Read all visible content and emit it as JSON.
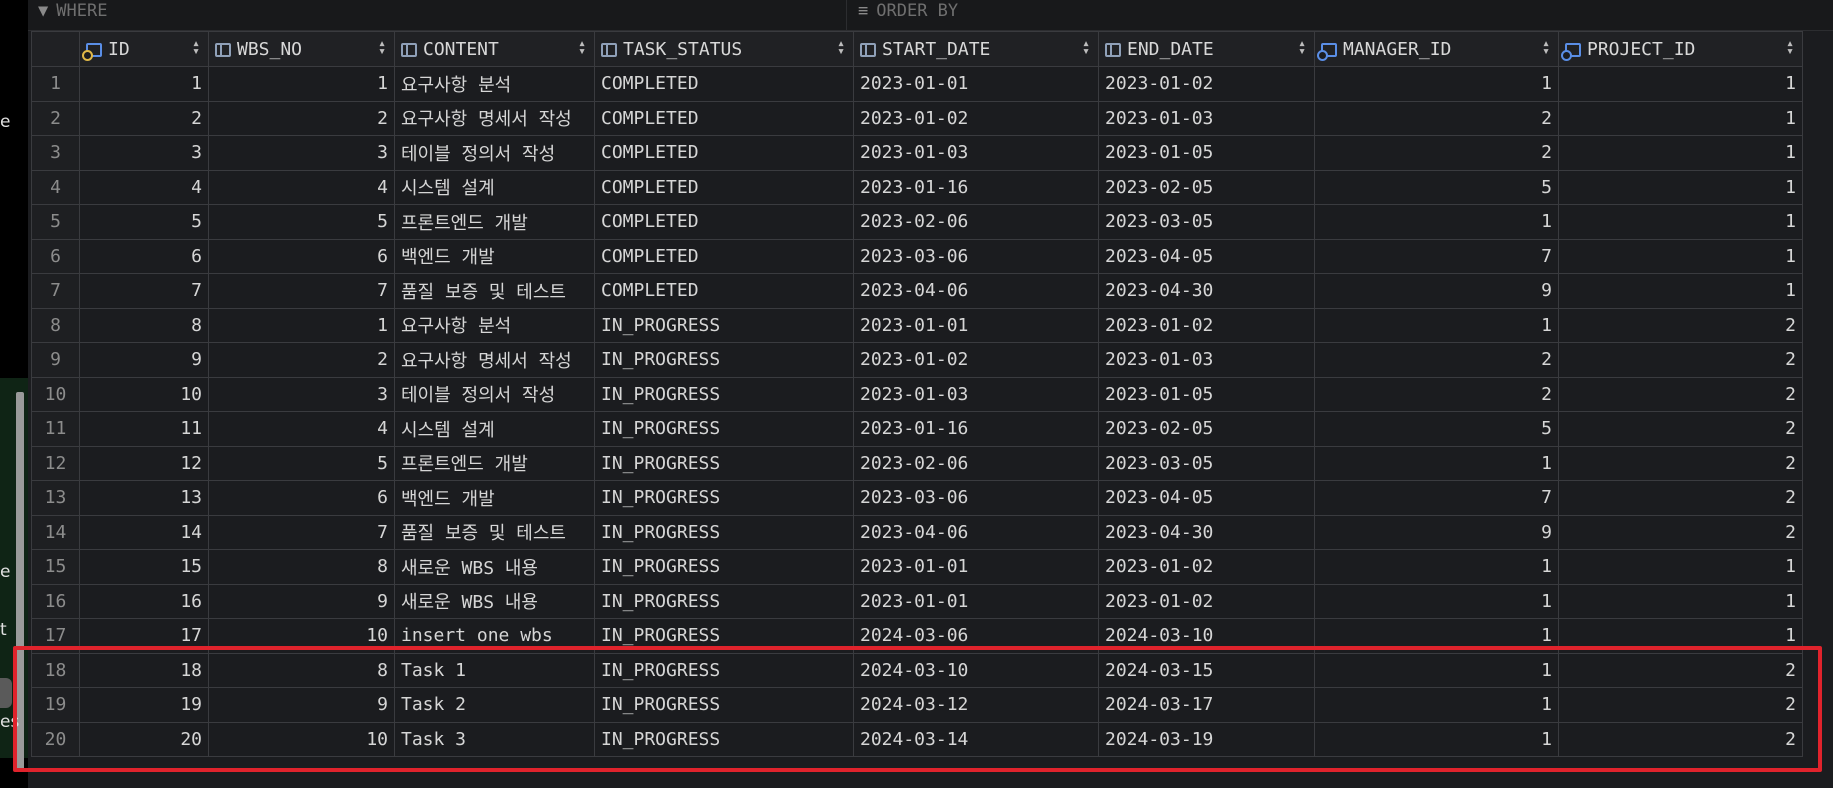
{
  "filterbar": {
    "where_label": "WHERE",
    "orderby_label": "ORDER BY"
  },
  "left_fragments": [
    "e",
    "e",
    "t",
    "es"
  ],
  "columns": [
    {
      "label": "ID",
      "icon": "primary-key-icon"
    },
    {
      "label": "WBS_NO",
      "icon": "column-icon"
    },
    {
      "label": "CONTENT",
      "icon": "column-icon"
    },
    {
      "label": "TASK_STATUS",
      "icon": "column-icon"
    },
    {
      "label": "START_DATE",
      "icon": "column-icon"
    },
    {
      "label": "END_DATE",
      "icon": "column-icon"
    },
    {
      "label": "MANAGER_ID",
      "icon": "foreign-key-icon"
    },
    {
      "label": "PROJECT_ID",
      "icon": "foreign-key-icon"
    }
  ],
  "rows": [
    {
      "n": "1",
      "id": "1",
      "wbs": "1",
      "content": "요구사항 분석",
      "status": "COMPLETED",
      "start": "2023-01-01",
      "end": "2023-01-02",
      "manager": "1",
      "project": "1"
    },
    {
      "n": "2",
      "id": "2",
      "wbs": "2",
      "content": "요구사항 명세서 작성",
      "status": "COMPLETED",
      "start": "2023-01-02",
      "end": "2023-01-03",
      "manager": "2",
      "project": "1"
    },
    {
      "n": "3",
      "id": "3",
      "wbs": "3",
      "content": "테이블 정의서 작성",
      "status": "COMPLETED",
      "start": "2023-01-03",
      "end": "2023-01-05",
      "manager": "2",
      "project": "1"
    },
    {
      "n": "4",
      "id": "4",
      "wbs": "4",
      "content": "시스템 설계",
      "status": "COMPLETED",
      "start": "2023-01-16",
      "end": "2023-02-05",
      "manager": "5",
      "project": "1"
    },
    {
      "n": "5",
      "id": "5",
      "wbs": "5",
      "content": "프론트엔드 개발",
      "status": "COMPLETED",
      "start": "2023-02-06",
      "end": "2023-03-05",
      "manager": "1",
      "project": "1"
    },
    {
      "n": "6",
      "id": "6",
      "wbs": "6",
      "content": "백엔드 개발",
      "status": "COMPLETED",
      "start": "2023-03-06",
      "end": "2023-04-05",
      "manager": "7",
      "project": "1"
    },
    {
      "n": "7",
      "id": "7",
      "wbs": "7",
      "content": "품질 보증 및 테스트",
      "status": "COMPLETED",
      "start": "2023-04-06",
      "end": "2023-04-30",
      "manager": "9",
      "project": "1"
    },
    {
      "n": "8",
      "id": "8",
      "wbs": "1",
      "content": "요구사항 분석",
      "status": "IN_PROGRESS",
      "start": "2023-01-01",
      "end": "2023-01-02",
      "manager": "1",
      "project": "2"
    },
    {
      "n": "9",
      "id": "9",
      "wbs": "2",
      "content": "요구사항 명세서 작성",
      "status": "IN_PROGRESS",
      "start": "2023-01-02",
      "end": "2023-01-03",
      "manager": "2",
      "project": "2"
    },
    {
      "n": "10",
      "id": "10",
      "wbs": "3",
      "content": "테이블 정의서 작성",
      "status": "IN_PROGRESS",
      "start": "2023-01-03",
      "end": "2023-01-05",
      "manager": "2",
      "project": "2"
    },
    {
      "n": "11",
      "id": "11",
      "wbs": "4",
      "content": "시스템 설계",
      "status": "IN_PROGRESS",
      "start": "2023-01-16",
      "end": "2023-02-05",
      "manager": "5",
      "project": "2"
    },
    {
      "n": "12",
      "id": "12",
      "wbs": "5",
      "content": "프론트엔드 개발",
      "status": "IN_PROGRESS",
      "start": "2023-02-06",
      "end": "2023-03-05",
      "manager": "1",
      "project": "2"
    },
    {
      "n": "13",
      "id": "13",
      "wbs": "6",
      "content": "백엔드 개발",
      "status": "IN_PROGRESS",
      "start": "2023-03-06",
      "end": "2023-04-05",
      "manager": "7",
      "project": "2"
    },
    {
      "n": "14",
      "id": "14",
      "wbs": "7",
      "content": "품질 보증 및 테스트",
      "status": "IN_PROGRESS",
      "start": "2023-04-06",
      "end": "2023-04-30",
      "manager": "9",
      "project": "2"
    },
    {
      "n": "15",
      "id": "15",
      "wbs": "8",
      "content": "새로운 WBS 내용",
      "status": "IN_PROGRESS",
      "start": "2023-01-01",
      "end": "2023-01-02",
      "manager": "1",
      "project": "1"
    },
    {
      "n": "16",
      "id": "16",
      "wbs": "9",
      "content": "새로운 WBS 내용",
      "status": "IN_PROGRESS",
      "start": "2023-01-01",
      "end": "2023-01-02",
      "manager": "1",
      "project": "1"
    },
    {
      "n": "17",
      "id": "17",
      "wbs": "10",
      "content": "insert one wbs",
      "status": "IN_PROGRESS",
      "start": "2024-03-06",
      "end": "2024-03-10",
      "manager": "1",
      "project": "1"
    },
    {
      "n": "18",
      "id": "18",
      "wbs": "8",
      "content": "Task 1",
      "status": "IN_PROGRESS",
      "start": "2024-03-10",
      "end": "2024-03-15",
      "manager": "1",
      "project": "2"
    },
    {
      "n": "19",
      "id": "19",
      "wbs": "9",
      "content": "Task 2",
      "status": "IN_PROGRESS",
      "start": "2024-03-12",
      "end": "2024-03-17",
      "manager": "1",
      "project": "2"
    },
    {
      "n": "20",
      "id": "20",
      "wbs": "10",
      "content": "Task 3",
      "status": "IN_PROGRESS",
      "start": "2024-03-14",
      "end": "2024-03-19",
      "manager": "1",
      "project": "2"
    }
  ],
  "highlight_color": "#e0232c"
}
